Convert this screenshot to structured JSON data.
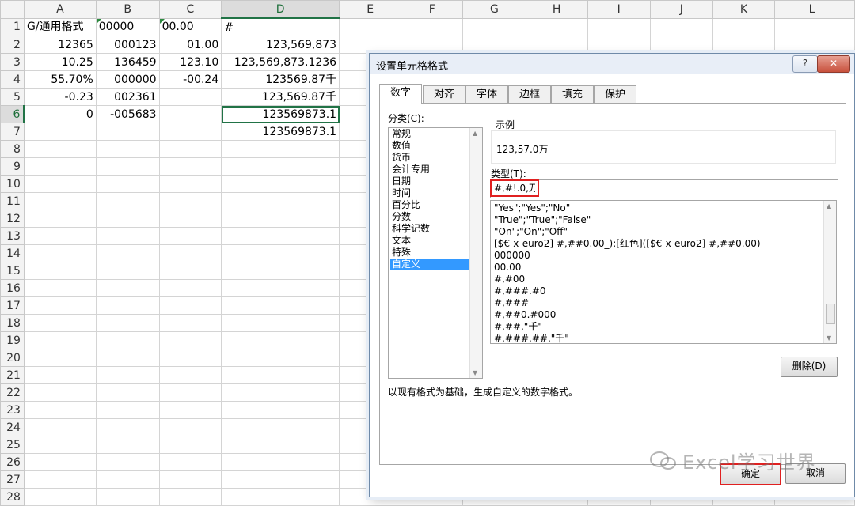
{
  "sheet": {
    "columns": [
      "A",
      "B",
      "C",
      "D",
      "E",
      "F",
      "G",
      "H",
      "I",
      "J",
      "K",
      "L"
    ],
    "rows": [
      {
        "n": "1",
        "cells": [
          "G/通用格式",
          "00000",
          "00.00",
          "#",
          "",
          "",
          "",
          "",
          "",
          "",
          "",
          ""
        ]
      },
      {
        "n": "2",
        "cells": [
          "12365",
          "000123",
          "01.00",
          "123,569,873",
          "",
          "",
          "",
          "",
          "",
          "",
          "",
          ""
        ]
      },
      {
        "n": "3",
        "cells": [
          "10.25",
          "136459",
          "123.10",
          "123,569,873.1236",
          "",
          "",
          "",
          "",
          "",
          "",
          "",
          ""
        ]
      },
      {
        "n": "4",
        "cells": [
          "55.70%",
          "000000",
          "-00.24",
          "123569.87千",
          "",
          "",
          "",
          "",
          "",
          "",
          "",
          ""
        ]
      },
      {
        "n": "5",
        "cells": [
          "-0.23",
          "002361",
          "",
          "123,569.87千",
          "",
          "",
          "",
          "",
          "",
          "",
          "",
          ""
        ]
      },
      {
        "n": "6",
        "cells": [
          "0",
          "-005683",
          "",
          "123569873.1",
          "",
          "",
          "",
          "",
          "",
          "",
          "",
          ""
        ]
      },
      {
        "n": "7",
        "cells": [
          "",
          "",
          "",
          "123569873.1",
          "",
          "",
          "",
          "",
          "",
          "",
          "",
          ""
        ]
      },
      {
        "n": "8",
        "cells": [
          "",
          "",
          "",
          "",
          "",
          "",
          "",
          "",
          "",
          "",
          "",
          ""
        ]
      },
      {
        "n": "9",
        "cells": [
          "",
          "",
          "",
          "",
          "",
          "",
          "",
          "",
          "",
          "",
          "",
          ""
        ]
      },
      {
        "n": "10",
        "cells": [
          "",
          "",
          "",
          "",
          "",
          "",
          "",
          "",
          "",
          "",
          "",
          ""
        ]
      },
      {
        "n": "11",
        "cells": [
          "",
          "",
          "",
          "",
          "",
          "",
          "",
          "",
          "",
          "",
          "",
          ""
        ]
      },
      {
        "n": "12",
        "cells": [
          "",
          "",
          "",
          "",
          "",
          "",
          "",
          "",
          "",
          "",
          "",
          ""
        ]
      },
      {
        "n": "13",
        "cells": [
          "",
          "",
          "",
          "",
          "",
          "",
          "",
          "",
          "",
          "",
          "",
          ""
        ]
      },
      {
        "n": "14",
        "cells": [
          "",
          "",
          "",
          "",
          "",
          "",
          "",
          "",
          "",
          "",
          "",
          ""
        ]
      },
      {
        "n": "15",
        "cells": [
          "",
          "",
          "",
          "",
          "",
          "",
          "",
          "",
          "",
          "",
          "",
          ""
        ]
      },
      {
        "n": "16",
        "cells": [
          "",
          "",
          "",
          "",
          "",
          "",
          "",
          "",
          "",
          "",
          "",
          ""
        ]
      },
      {
        "n": "17",
        "cells": [
          "",
          "",
          "",
          "",
          "",
          "",
          "",
          "",
          "",
          "",
          "",
          ""
        ]
      },
      {
        "n": "18",
        "cells": [
          "",
          "",
          "",
          "",
          "",
          "",
          "",
          "",
          "",
          "",
          "",
          ""
        ]
      },
      {
        "n": "19",
        "cells": [
          "",
          "",
          "",
          "",
          "",
          "",
          "",
          "",
          "",
          "",
          "",
          ""
        ]
      },
      {
        "n": "20",
        "cells": [
          "",
          "",
          "",
          "",
          "",
          "",
          "",
          "",
          "",
          "",
          "",
          ""
        ]
      },
      {
        "n": "21",
        "cells": [
          "",
          "",
          "",
          "",
          "",
          "",
          "",
          "",
          "",
          "",
          "",
          ""
        ]
      },
      {
        "n": "22",
        "cells": [
          "",
          "",
          "",
          "",
          "",
          "",
          "",
          "",
          "",
          "",
          "",
          ""
        ]
      },
      {
        "n": "23",
        "cells": [
          "",
          "",
          "",
          "",
          "",
          "",
          "",
          "",
          "",
          "",
          "",
          ""
        ]
      },
      {
        "n": "24",
        "cells": [
          "",
          "",
          "",
          "",
          "",
          "",
          "",
          "",
          "",
          "",
          "",
          ""
        ]
      },
      {
        "n": "25",
        "cells": [
          "",
          "",
          "",
          "",
          "",
          "",
          "",
          "",
          "",
          "",
          "",
          ""
        ]
      },
      {
        "n": "26",
        "cells": [
          "",
          "",
          "",
          "",
          "",
          "",
          "",
          "",
          "",
          "",
          "",
          ""
        ]
      },
      {
        "n": "27",
        "cells": [
          "",
          "",
          "",
          "",
          "",
          "",
          "",
          "",
          "",
          "",
          "",
          ""
        ]
      },
      {
        "n": "28",
        "cells": [
          "",
          "",
          "",
          "",
          "",
          "",
          "",
          "",
          "",
          "",
          "",
          ""
        ]
      }
    ]
  },
  "dialog": {
    "title": "设置单元格格式",
    "help_label": "?",
    "close_label": "✕",
    "tabs": [
      "数字",
      "对齐",
      "字体",
      "边框",
      "填充",
      "保护"
    ],
    "category_label": "分类(C):",
    "categories": [
      "常规",
      "数值",
      "货币",
      "会计专用",
      "日期",
      "时间",
      "百分比",
      "分数",
      "科学记数",
      "文本",
      "特殊",
      "自定义"
    ],
    "sample_label": "示例",
    "sample_value": "123,57.0万",
    "type_label": "类型(T):",
    "type_value": "#,#!.0,万",
    "formats": [
      "\"Yes\";\"Yes\";\"No\"",
      "\"True\";\"True\";\"False\"",
      "\"On\";\"On\";\"Off\"",
      "[$€-x-euro2] #,##0.00_);[红色]([$€-x-euro2] #,##0.00)",
      "000000",
      "00.00",
      "#,#00",
      "#,###.#0",
      "#,###",
      "#,##0.#000",
      "#,##,\"千\"",
      "#,###.##,\"千\""
    ],
    "delete_label": "删除(D)",
    "hint": "以现有格式为基础，生成自定义的数字格式。",
    "ok_label": "确定",
    "cancel_label": "取消"
  },
  "watermark": "Excel学习世界"
}
